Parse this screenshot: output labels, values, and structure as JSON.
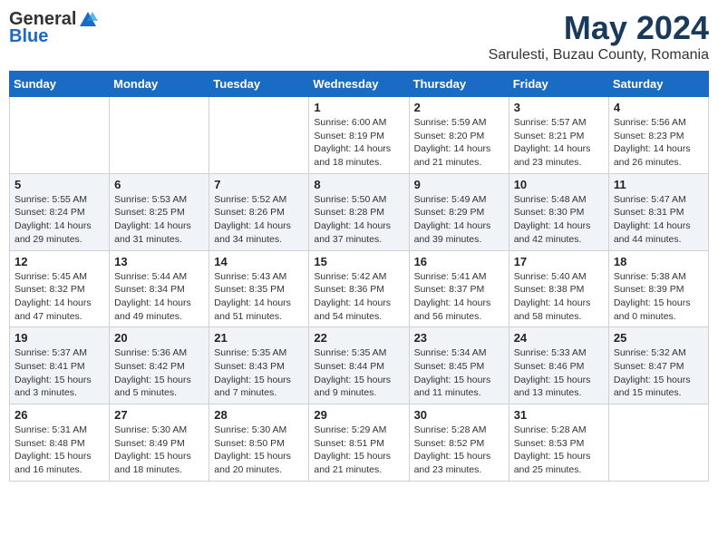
{
  "logo": {
    "general": "General",
    "blue": "Blue"
  },
  "title": "May 2024",
  "subtitle": "Sarulesti, Buzau County, Romania",
  "headers": [
    "Sunday",
    "Monday",
    "Tuesday",
    "Wednesday",
    "Thursday",
    "Friday",
    "Saturday"
  ],
  "weeks": [
    [
      {
        "day": "",
        "info": ""
      },
      {
        "day": "",
        "info": ""
      },
      {
        "day": "",
        "info": ""
      },
      {
        "day": "1",
        "info": "Sunrise: 6:00 AM\nSunset: 8:19 PM\nDaylight: 14 hours\nand 18 minutes."
      },
      {
        "day": "2",
        "info": "Sunrise: 5:59 AM\nSunset: 8:20 PM\nDaylight: 14 hours\nand 21 minutes."
      },
      {
        "day": "3",
        "info": "Sunrise: 5:57 AM\nSunset: 8:21 PM\nDaylight: 14 hours\nand 23 minutes."
      },
      {
        "day": "4",
        "info": "Sunrise: 5:56 AM\nSunset: 8:23 PM\nDaylight: 14 hours\nand 26 minutes."
      }
    ],
    [
      {
        "day": "5",
        "info": "Sunrise: 5:55 AM\nSunset: 8:24 PM\nDaylight: 14 hours\nand 29 minutes."
      },
      {
        "day": "6",
        "info": "Sunrise: 5:53 AM\nSunset: 8:25 PM\nDaylight: 14 hours\nand 31 minutes."
      },
      {
        "day": "7",
        "info": "Sunrise: 5:52 AM\nSunset: 8:26 PM\nDaylight: 14 hours\nand 34 minutes."
      },
      {
        "day": "8",
        "info": "Sunrise: 5:50 AM\nSunset: 8:28 PM\nDaylight: 14 hours\nand 37 minutes."
      },
      {
        "day": "9",
        "info": "Sunrise: 5:49 AM\nSunset: 8:29 PM\nDaylight: 14 hours\nand 39 minutes."
      },
      {
        "day": "10",
        "info": "Sunrise: 5:48 AM\nSunset: 8:30 PM\nDaylight: 14 hours\nand 42 minutes."
      },
      {
        "day": "11",
        "info": "Sunrise: 5:47 AM\nSunset: 8:31 PM\nDaylight: 14 hours\nand 44 minutes."
      }
    ],
    [
      {
        "day": "12",
        "info": "Sunrise: 5:45 AM\nSunset: 8:32 PM\nDaylight: 14 hours\nand 47 minutes."
      },
      {
        "day": "13",
        "info": "Sunrise: 5:44 AM\nSunset: 8:34 PM\nDaylight: 14 hours\nand 49 minutes."
      },
      {
        "day": "14",
        "info": "Sunrise: 5:43 AM\nSunset: 8:35 PM\nDaylight: 14 hours\nand 51 minutes."
      },
      {
        "day": "15",
        "info": "Sunrise: 5:42 AM\nSunset: 8:36 PM\nDaylight: 14 hours\nand 54 minutes."
      },
      {
        "day": "16",
        "info": "Sunrise: 5:41 AM\nSunset: 8:37 PM\nDaylight: 14 hours\nand 56 minutes."
      },
      {
        "day": "17",
        "info": "Sunrise: 5:40 AM\nSunset: 8:38 PM\nDaylight: 14 hours\nand 58 minutes."
      },
      {
        "day": "18",
        "info": "Sunrise: 5:38 AM\nSunset: 8:39 PM\nDaylight: 15 hours\nand 0 minutes."
      }
    ],
    [
      {
        "day": "19",
        "info": "Sunrise: 5:37 AM\nSunset: 8:41 PM\nDaylight: 15 hours\nand 3 minutes."
      },
      {
        "day": "20",
        "info": "Sunrise: 5:36 AM\nSunset: 8:42 PM\nDaylight: 15 hours\nand 5 minutes."
      },
      {
        "day": "21",
        "info": "Sunrise: 5:35 AM\nSunset: 8:43 PM\nDaylight: 15 hours\nand 7 minutes."
      },
      {
        "day": "22",
        "info": "Sunrise: 5:35 AM\nSunset: 8:44 PM\nDaylight: 15 hours\nand 9 minutes."
      },
      {
        "day": "23",
        "info": "Sunrise: 5:34 AM\nSunset: 8:45 PM\nDaylight: 15 hours\nand 11 minutes."
      },
      {
        "day": "24",
        "info": "Sunrise: 5:33 AM\nSunset: 8:46 PM\nDaylight: 15 hours\nand 13 minutes."
      },
      {
        "day": "25",
        "info": "Sunrise: 5:32 AM\nSunset: 8:47 PM\nDaylight: 15 hours\nand 15 minutes."
      }
    ],
    [
      {
        "day": "26",
        "info": "Sunrise: 5:31 AM\nSunset: 8:48 PM\nDaylight: 15 hours\nand 16 minutes."
      },
      {
        "day": "27",
        "info": "Sunrise: 5:30 AM\nSunset: 8:49 PM\nDaylight: 15 hours\nand 18 minutes."
      },
      {
        "day": "28",
        "info": "Sunrise: 5:30 AM\nSunset: 8:50 PM\nDaylight: 15 hours\nand 20 minutes."
      },
      {
        "day": "29",
        "info": "Sunrise: 5:29 AM\nSunset: 8:51 PM\nDaylight: 15 hours\nand 21 minutes."
      },
      {
        "day": "30",
        "info": "Sunrise: 5:28 AM\nSunset: 8:52 PM\nDaylight: 15 hours\nand 23 minutes."
      },
      {
        "day": "31",
        "info": "Sunrise: 5:28 AM\nSunset: 8:53 PM\nDaylight: 15 hours\nand 25 minutes."
      },
      {
        "day": "",
        "info": ""
      }
    ]
  ]
}
